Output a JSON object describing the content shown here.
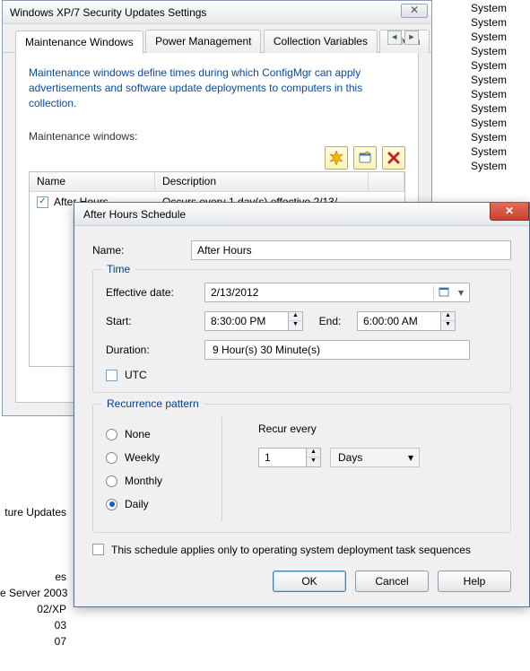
{
  "bg_right_item": "System",
  "bg_right_count": 12,
  "bg_left": {
    "l1": "ture Updates",
    "l2": "es",
    "l3": "e Server 2003",
    "l4": "02/XP",
    "l5": "03",
    "l6": "07"
  },
  "back": {
    "title": "Windows XP/7 Security Updates Settings",
    "tabs": {
      "t1": "Maintenance Windows",
      "t2": "Power Management",
      "t3": "Collection Variables",
      "t4": "Advan"
    },
    "info": "Maintenance windows define times during which ConfigMgr can apply advertisements and software update deployments to computers in this collection.",
    "mw_label": "Maintenance windows:",
    "headers": {
      "name": "Name",
      "desc": "Description"
    },
    "row1": {
      "name": "After Hours",
      "desc": "Occurs every 1 day(s) effective 2/13/…"
    }
  },
  "front": {
    "title": "After Hours Schedule",
    "name_label": "Name:",
    "name_value": "After Hours",
    "time_legend": "Time",
    "eff_label": "Effective date:",
    "eff_value": "2/13/2012",
    "start_label": "Start:",
    "start_value": "8:30:00 PM",
    "end_label": "End:",
    "end_value": "6:00:00 AM",
    "dur_label": "Duration:",
    "dur_value": "9 Hour(s) 30 Minute(s)",
    "utc_label": "UTC",
    "recur_legend": "Recurrence pattern",
    "r_none": "None",
    "r_weekly": "Weekly",
    "r_monthly": "Monthly",
    "r_daily": "Daily",
    "recur_every_label": "Recur every",
    "recur_every_value": "1",
    "recur_unit": "Days",
    "osd_label": "This schedule applies only to operating system deployment task sequences",
    "btn_ok": "OK",
    "btn_cancel": "Cancel",
    "btn_help": "Help"
  }
}
